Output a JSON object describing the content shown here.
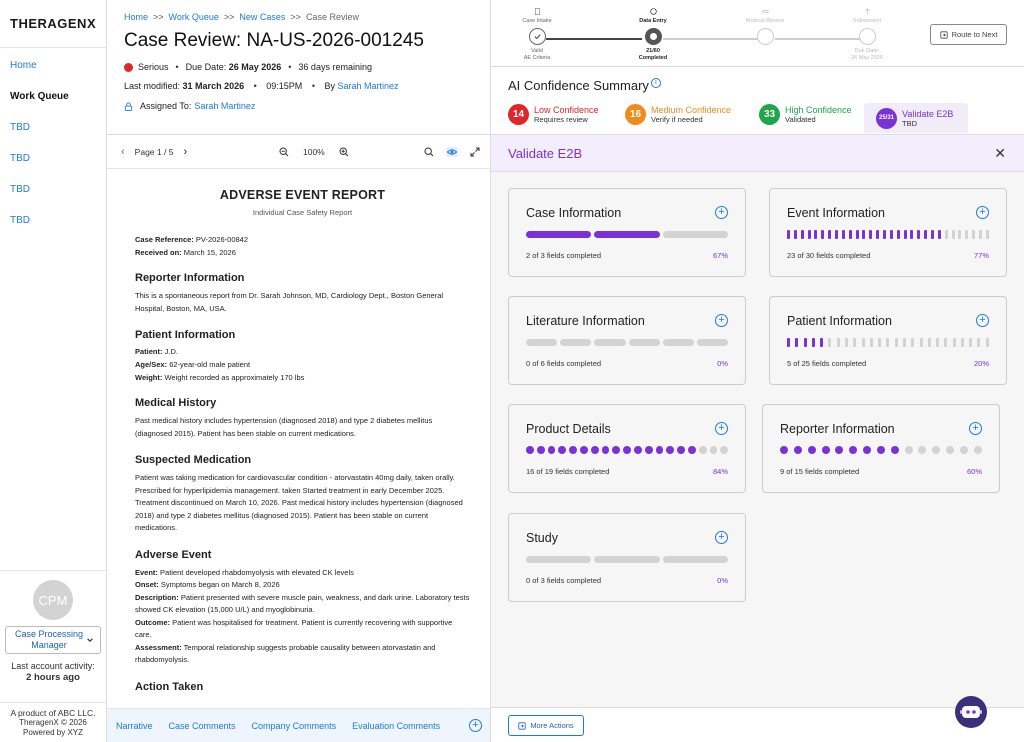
{
  "app": {
    "logo": "THERAGENX"
  },
  "sidebar": {
    "items": [
      {
        "label": "Home"
      },
      {
        "label": "Work Queue"
      },
      {
        "label": "TBD"
      },
      {
        "label": "TBD"
      },
      {
        "label": "TBD"
      },
      {
        "label": "TBD"
      }
    ],
    "avatar_initials": "CPM",
    "role": "Case Processing Manager",
    "last_activity_label": "Last account activity:",
    "last_activity_value": "2 hours ago",
    "footer": [
      "A product of ABC LLC.",
      "TheragenX © 2026",
      "Powered by XYZ"
    ]
  },
  "header": {
    "breadcrumb": [
      "Home",
      "Work Queue",
      "New Cases",
      "Case Review"
    ],
    "breadcrumb_sep": ">>",
    "title": "Case Review: NA-US-2026-001245",
    "seriousness": "Serious",
    "due_date_label": "Due Date:",
    "due_date": "26 May 2026",
    "days_remaining": "36 days remaining",
    "last_modified_label": "Last modified:",
    "last_modified_date": "31 March 2026",
    "last_modified_time": "09:15PM",
    "by_label": "By",
    "by_user": "Sarah Martinez",
    "assigned_label": "Assigned To:",
    "assigned_user": "Sarah Martinez",
    "serious_color": "#e0252b"
  },
  "viewer": {
    "page_label": "Page 1 / 5",
    "zoom": "100%"
  },
  "document": {
    "title": "ADVERSE EVENT REPORT",
    "subtitle": "Individual Case Safety Report",
    "case_ref_label": "Case Reference:",
    "case_ref": "PV-2026-00842",
    "received_label": "Received on:",
    "received": "March 15, 2026",
    "reporter_h": "Reporter Information",
    "reporter_p": "This is a spontaneous report from Dr. Sarah Johnson, MD, Cardiology Dept., Boston General Hospital, Boston, MA, USA.",
    "patient_h": "Patient Information",
    "patient_label": "Patient:",
    "patient": "J.D.",
    "agesex_label": "Age/Sex:",
    "agesex": "62-year-old male patient",
    "weight_label": "Weight:",
    "weight": "Weight recorded as approximately 170 lbs",
    "history_h": "Medical History",
    "history_p": "Past medical history includes hypertension (diagnosed 2018) and type 2 diabetes mellitus (diagnosed 2015). Patient has been stable on current medications.",
    "suspected_h": "Suspected Medication",
    "suspected_p": "Patient was taking medication for cardiovascular condition - atorvastatin 40mg daily, taken orally. Prescribed for hyperlipidemia management. taken Started treatment in early December 2025. Treatment discontinued on March 10, 2026. Past medical history includes hypertension (diagnosed 2018) and type 2 diabetes mellitus (diagnosed 2015). Patient has been stable on current medications.",
    "ae_h": "Adverse Event",
    "event_label": "Event:",
    "event": "Patient developed rhabdomyolysis with elevated CK levels",
    "onset_label": "Onset:",
    "onset": "Symptoms began on March 8, 2026",
    "desc_label": "Description:",
    "desc": "Patient presented with severe muscle pain, weakness, and dark urine. Laboratory tests showed CK elevation (15,000 U/L) and myoglobinuria.",
    "outcome_label": "Outcome:",
    "outcome": "Patient was hospitalised for treatment. Patient is currently recovering with supportive care.",
    "assess_label": "Assessment:",
    "assess": "Temporal relationship suggests probable causality between atorvastatin and rhabdomyolysis.",
    "action_h": "Action Taken"
  },
  "doc_tabs": [
    "Narrative",
    "Case Comments",
    "Company Comments",
    "Evaluation Comments"
  ],
  "stepper": {
    "steps": [
      {
        "label": "Case Intake",
        "caption1": "Valid",
        "caption2": "AE Criteria"
      },
      {
        "label": "Data Entry",
        "caption1": "21/60",
        "caption2": "Completed"
      },
      {
        "label": "Medical Review",
        "caption1": "",
        "caption2": ""
      },
      {
        "label": "Submission",
        "caption1": "Due Date:",
        "caption2": "26 May 2026"
      }
    ],
    "route_button": "Route to Next"
  },
  "confidence": {
    "title": "AI Confidence Summary",
    "chips": [
      {
        "count": "14",
        "label": "Low Confidence",
        "sub": "Requires review",
        "color": "#e0252b"
      },
      {
        "count": "16",
        "label": "Medium Confidence",
        "sub": "Verify if needed",
        "color": "#f08a1c"
      },
      {
        "count": "33",
        "label": "High Confidence",
        "sub": "Validated",
        "color": "#1fa54a"
      },
      {
        "count": "25/31",
        "label": "Validate E2B",
        "sub": "TBD",
        "color": "#7a32d6"
      }
    ]
  },
  "validate": {
    "title": "Validate E2B",
    "cards": [
      {
        "title": "Case Information",
        "done": 2,
        "total": 3,
        "completed_text": "2 of 3 fields completed",
        "pct": "67%",
        "style": "seg"
      },
      {
        "title": "Event Information",
        "done": 23,
        "total": 30,
        "completed_text": "23 of 30 fields completed",
        "pct": "77%",
        "style": "tick"
      },
      {
        "title": "Literature Information",
        "done": 0,
        "total": 6,
        "completed_text": "0 of 6 fields completed",
        "pct": "0%",
        "style": "seg"
      },
      {
        "title": "Patient Information",
        "done": 5,
        "total": 25,
        "completed_text": "5 of 25 fields completed",
        "pct": "20%",
        "style": "tick"
      },
      {
        "title": "Product Details",
        "done": 16,
        "total": 19,
        "completed_text": "16 of 19 fields completed",
        "pct": "84%",
        "style": "dot"
      },
      {
        "title": "Reporter Information",
        "done": 9,
        "total": 15,
        "completed_text": "9 of 15 fields completed",
        "pct": "60%",
        "style": "dot"
      },
      {
        "title": "Study",
        "done": 0,
        "total": 3,
        "completed_text": "0 of 3 fields completed",
        "pct": "0%",
        "style": "seg"
      }
    ],
    "more_actions": "More Actions"
  }
}
